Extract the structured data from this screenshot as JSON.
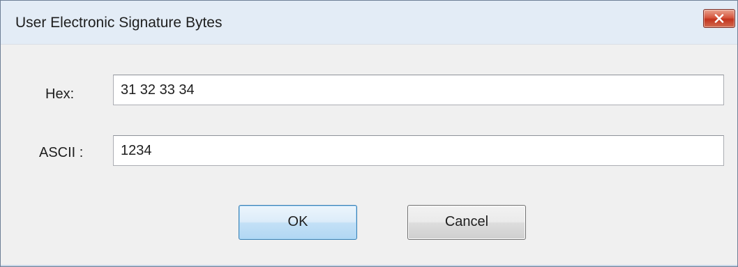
{
  "window": {
    "title": "User Electronic Signature Bytes",
    "close_icon": "close-x-icon"
  },
  "form": {
    "hex_label": "Hex:",
    "hex_value": "31 32 33 34",
    "ascii_label": "ASCII :",
    "ascii_value": "1234"
  },
  "buttons": {
    "ok_label": "OK",
    "cancel_label": "Cancel"
  },
  "colors": {
    "titlebar": "#e3ecf6",
    "dialog_bg": "#f0f0f0",
    "close_button": "#c2341e",
    "default_button_border": "#3c7fb1"
  }
}
